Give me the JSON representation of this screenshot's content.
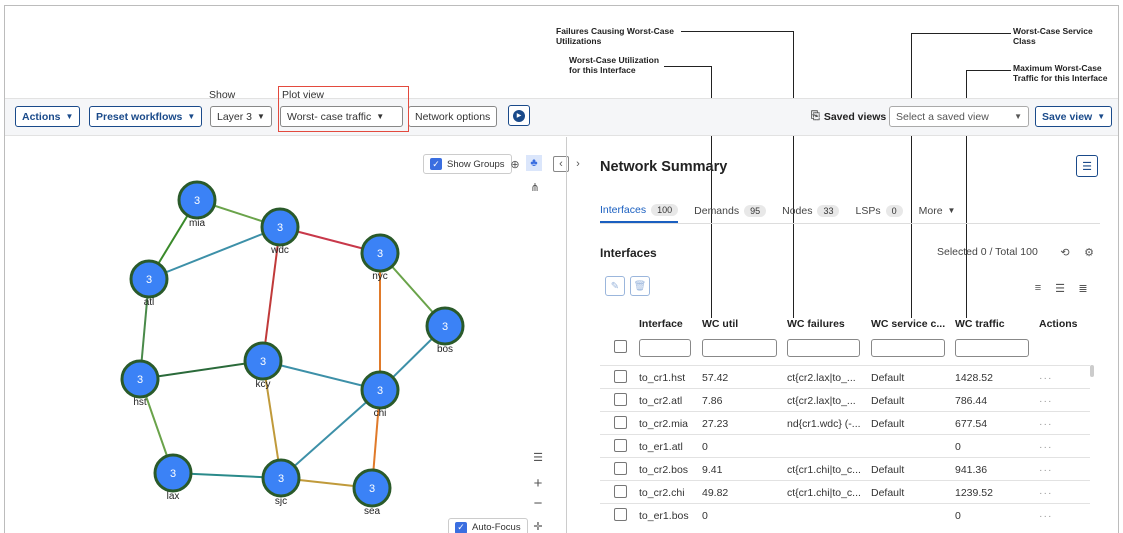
{
  "annotations": {
    "failures": "Failures Causing Worst-Case Utilizations",
    "util": "Worst-Case Utilization for this Interface",
    "service": "Worst-Case Service Class",
    "traffic": "Maximum Worst-Case Traffic for this Interface"
  },
  "toolbar": {
    "actions": "Actions",
    "preset": "Preset workflows",
    "show_label": "Show",
    "layer": "Layer 3",
    "plotview_label": "Plot view",
    "plotview": "Worst- case traffic",
    "network_options": "Network options",
    "saved_views": "Saved views",
    "saved_placeholder": "Select a saved view",
    "save_view": "Save view"
  },
  "topology": {
    "show_groups": "Show Groups",
    "auto_focus": "Auto-Focus",
    "nodes": [
      {
        "id": "mia",
        "count": "3"
      },
      {
        "id": "wdc",
        "count": "3"
      },
      {
        "id": "nyc",
        "count": "3"
      },
      {
        "id": "atl",
        "count": "3"
      },
      {
        "id": "bos",
        "count": "3"
      },
      {
        "id": "kcy",
        "count": "3"
      },
      {
        "id": "hst",
        "count": "3"
      },
      {
        "id": "chi",
        "count": "3"
      },
      {
        "id": "lax",
        "count": "3"
      },
      {
        "id": "sjc",
        "count": "3"
      },
      {
        "id": "sea",
        "count": "3"
      }
    ],
    "colors": {
      "node_fill": "#3b82f6",
      "node_stroke": "#2a5a2a"
    }
  },
  "summary": {
    "title": "Network Summary",
    "tabs": [
      {
        "label": "Interfaces",
        "count": "100"
      },
      {
        "label": "Demands",
        "count": "95"
      },
      {
        "label": "Nodes",
        "count": "33"
      },
      {
        "label": "LSPs",
        "count": "0"
      },
      {
        "label": "More",
        "count": ""
      }
    ],
    "section": "Interfaces",
    "selected_info": "Selected 0 / Total 100",
    "columns": [
      "Interface",
      "WC util",
      "WC failures",
      "WC service c...",
      "WC traffic",
      "Actions"
    ],
    "rows": [
      [
        "to_cr1.hst",
        "57.42",
        "ct{cr2.lax|to_...",
        "Default",
        "1428.52",
        "···"
      ],
      [
        "to_cr2.atl",
        "7.86",
        "ct{cr2.lax|to_...",
        "Default",
        "786.44",
        "···"
      ],
      [
        "to_cr2.mia",
        "27.23",
        "nd{cr1.wdc} (-...",
        "Default",
        "677.54",
        "···"
      ],
      [
        "to_er1.atl",
        "0",
        "",
        "",
        "0",
        "···"
      ],
      [
        "to_cr2.bos",
        "9.41",
        "ct{cr1.chi|to_c...",
        "Default",
        "941.36",
        "···"
      ],
      [
        "to_cr2.chi",
        "49.82",
        "ct{cr1.chi|to_c...",
        "Default",
        "1239.52",
        "···"
      ],
      [
        "to_er1.bos",
        "0",
        "",
        "",
        "0",
        "···"
      ]
    ]
  }
}
